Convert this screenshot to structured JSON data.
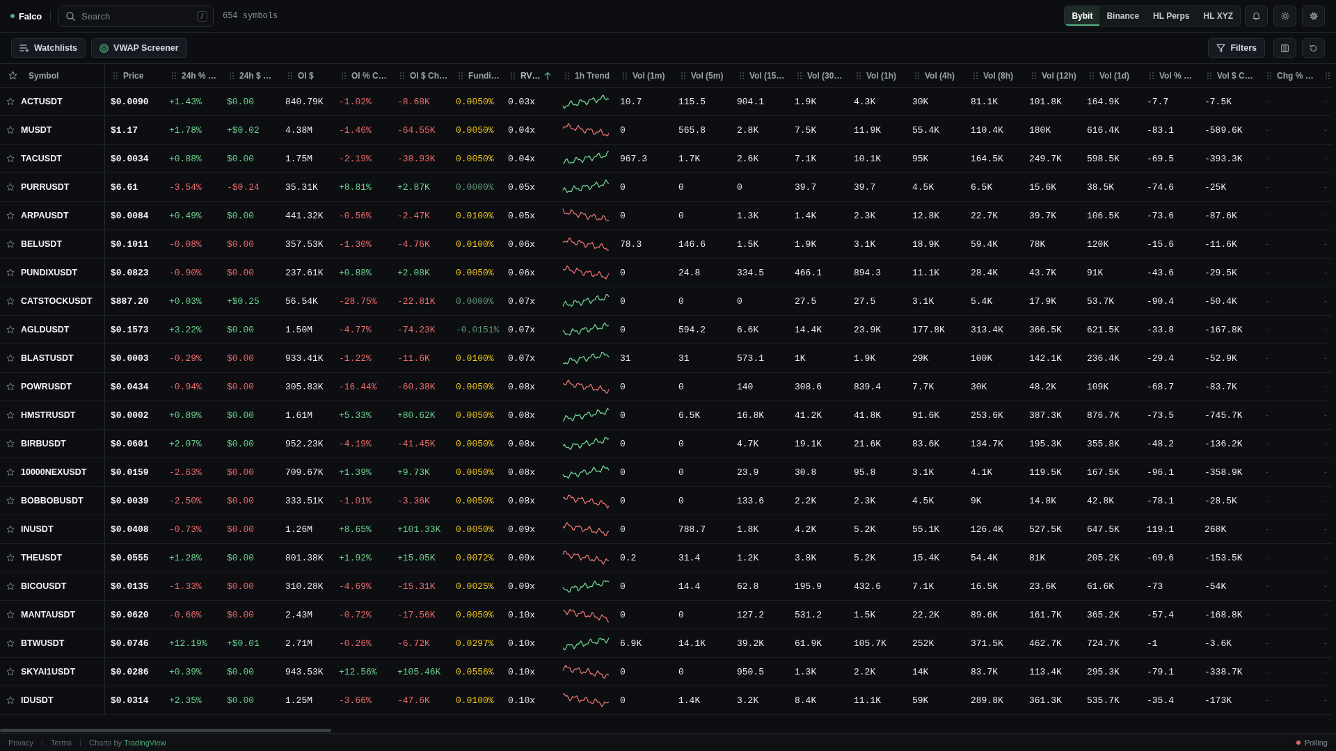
{
  "topbar": {
    "logo": "Falco",
    "search": {
      "placeholder": "Search",
      "shortcut": "/"
    },
    "symbol_count": "654 symbols",
    "exchanges": [
      {
        "label": "Bybit",
        "selected": true
      },
      {
        "label": "Binance",
        "selected": false
      },
      {
        "label": "HL Perps",
        "selected": false
      },
      {
        "label": "HL XYZ",
        "selected": false
      }
    ]
  },
  "toolbar": {
    "watchlists_button": "Watchlists",
    "vwap_button": "VWAP Screener",
    "filters_button": "Filters"
  },
  "table": {
    "symbol_header": "Symbol",
    "columns": [
      {
        "label": "Price",
        "kind": "price",
        "sorted": false
      },
      {
        "label": "24h % …",
        "kind": "day",
        "sorted": false
      },
      {
        "label": "24h $ …",
        "kind": "day",
        "sorted": false
      },
      {
        "label": "OI $",
        "kind": "plain",
        "sorted": false
      },
      {
        "label": "OI % C…",
        "kind": "oi",
        "sorted": false
      },
      {
        "label": "OI $ Ch…",
        "kind": "oi",
        "sorted": false
      },
      {
        "label": "Fundi…",
        "kind": "funding",
        "sorted": false
      },
      {
        "label": "RV…",
        "kind": "plain",
        "sorted": true
      },
      {
        "label": "1h Trend",
        "kind": "trend",
        "sorted": false
      },
      {
        "label": "Vol (1m)",
        "kind": "plain",
        "sorted": false
      },
      {
        "label": "Vol (5m)",
        "kind": "plain",
        "sorted": false
      },
      {
        "label": "Vol (15…",
        "kind": "plain",
        "sorted": false
      },
      {
        "label": "Vol (30…",
        "kind": "plain",
        "sorted": false
      },
      {
        "label": "Vol (1h)",
        "kind": "plain",
        "sorted": false
      },
      {
        "label": "Vol (4h)",
        "kind": "plain",
        "sorted": false
      },
      {
        "label": "Vol (8h)",
        "kind": "plain",
        "sorted": false
      },
      {
        "label": "Vol (12h)",
        "kind": "plain",
        "sorted": false
      },
      {
        "label": "Vol (1d)",
        "kind": "plain",
        "sorted": false
      },
      {
        "label": "Vol % …",
        "kind": "plain",
        "sorted": false
      },
      {
        "label": "Vol $ C…",
        "kind": "plain",
        "sorted": false
      },
      {
        "label": "Chg % …",
        "kind": "dash",
        "sorted": false
      },
      {
        "kind": "dash",
        "sorted": false
      }
    ],
    "rows": [
      {
        "symbol": "ACTUSDT",
        "starred": false,
        "day_up": true,
        "oi_up": false,
        "funding_positive": true,
        "trend_up": true,
        "cells": [
          "$0.0090",
          "+1.43%",
          "$0.00",
          "840.79K",
          "-1.02%",
          "-8.68K",
          "0.0050%",
          "0.03x",
          "",
          "10.7",
          "115.5",
          "904.1",
          "1.9K",
          "4.3K",
          "30K",
          "81.1K",
          "101.8K",
          "164.9K",
          "-7.7",
          "-7.5K",
          "-",
          "-"
        ]
      },
      {
        "symbol": "MUSDT",
        "starred": false,
        "day_up": true,
        "oi_up": false,
        "funding_positive": true,
        "trend_up": false,
        "cells": [
          "$1.17",
          "+1.78%",
          "+$0.02",
          "4.38M",
          "-1.46%",
          "-64.55K",
          "0.0050%",
          "0.04x",
          "",
          "0",
          "565.8",
          "2.8K",
          "7.5K",
          "11.9K",
          "55.4K",
          "110.4K",
          "180K",
          "616.4K",
          "-83.1",
          "-589.6K",
          "-",
          "-"
        ]
      },
      {
        "symbol": "TACUSDT",
        "starred": false,
        "day_up": true,
        "oi_up": false,
        "funding_positive": true,
        "trend_up": true,
        "cells": [
          "$0.0034",
          "+0.88%",
          "$0.00",
          "1.75M",
          "-2.19%",
          "-38.93K",
          "0.0050%",
          "0.04x",
          "",
          "967.3",
          "1.7K",
          "2.6K",
          "7.1K",
          "10.1K",
          "95K",
          "164.5K",
          "249.7K",
          "598.5K",
          "-69.5",
          "-393.3K",
          "-",
          "-"
        ]
      },
      {
        "symbol": "PURRUSDT",
        "starred": false,
        "day_up": false,
        "oi_up": true,
        "funding_positive": false,
        "trend_up": true,
        "cells": [
          "$6.61",
          "-3.54%",
          "-$0.24",
          "35.31K",
          "+8.81%",
          "+2.87K",
          "0.0000%",
          "0.05x",
          "",
          "0",
          "0",
          "0",
          "39.7",
          "39.7",
          "4.5K",
          "6.5K",
          "15.6K",
          "38.5K",
          "-74.6",
          "-25K",
          "-",
          "-"
        ]
      },
      {
        "symbol": "ARPAUSDT",
        "starred": false,
        "day_up": true,
        "oi_up": false,
        "funding_positive": true,
        "trend_up": false,
        "cells": [
          "$0.0084",
          "+0.49%",
          "$0.00",
          "441.32K",
          "-0.56%",
          "-2.47K",
          "0.0100%",
          "0.05x",
          "",
          "0",
          "0",
          "1.3K",
          "1.4K",
          "2.3K",
          "12.8K",
          "22.7K",
          "39.7K",
          "106.5K",
          "-73.6",
          "-87.6K",
          "-",
          "-"
        ]
      },
      {
        "symbol": "BELUSDT",
        "starred": false,
        "day_up": false,
        "oi_up": false,
        "funding_positive": true,
        "trend_up": false,
        "cells": [
          "$0.1011",
          "-0.08%",
          "$0.00",
          "357.53K",
          "-1.30%",
          "-4.76K",
          "0.0100%",
          "0.06x",
          "",
          "78.3",
          "146.6",
          "1.5K",
          "1.9K",
          "3.1K",
          "18.9K",
          "59.4K",
          "78K",
          "120K",
          "-15.6",
          "-11.6K",
          "-",
          "-"
        ]
      },
      {
        "symbol": "PUNDIXUSDT",
        "starred": false,
        "day_up": false,
        "oi_up": true,
        "funding_positive": true,
        "trend_up": false,
        "cells": [
          "$0.0823",
          "-0.90%",
          "$0.00",
          "237.61K",
          "+0.88%",
          "+2.08K",
          "0.0050%",
          "0.06x",
          "",
          "0",
          "24.8",
          "334.5",
          "466.1",
          "894.3",
          "11.1K",
          "28.4K",
          "43.7K",
          "91K",
          "-43.6",
          "-29.5K",
          "-",
          "-"
        ]
      },
      {
        "symbol": "CATSTOCKUSDT",
        "starred": false,
        "day_up": true,
        "oi_up": false,
        "funding_positive": false,
        "trend_up": true,
        "cells": [
          "$887.20",
          "+0.03%",
          "+$0.25",
          "56.54K",
          "-28.75%",
          "-22.81K",
          "0.0000%",
          "0.07x",
          "",
          "0",
          "0",
          "0",
          "27.5",
          "27.5",
          "3.1K",
          "5.4K",
          "17.9K",
          "53.7K",
          "-90.4",
          "-50.4K",
          "-",
          "-"
        ]
      },
      {
        "symbol": "AGLDUSDT",
        "starred": false,
        "day_up": true,
        "oi_up": false,
        "funding_positive": false,
        "trend_up": true,
        "cells": [
          "$0.1573",
          "+3.22%",
          "$0.00",
          "1.50M",
          "-4.77%",
          "-74.23K",
          "-0.0151%",
          "0.07x",
          "",
          "0",
          "594.2",
          "6.6K",
          "14.4K",
          "23.9K",
          "177.8K",
          "313.4K",
          "366.5K",
          "621.5K",
          "-33.8",
          "-167.8K",
          "-",
          "-"
        ]
      },
      {
        "symbol": "BLASTUSDT",
        "starred": false,
        "day_up": false,
        "oi_up": false,
        "funding_positive": true,
        "trend_up": true,
        "cells": [
          "$0.0003",
          "-0.29%",
          "$0.00",
          "933.41K",
          "-1.22%",
          "-11.6K",
          "0.0100%",
          "0.07x",
          "",
          "31",
          "31",
          "573.1",
          "1K",
          "1.9K",
          "29K",
          "100K",
          "142.1K",
          "236.4K",
          "-29.4",
          "-52.9K",
          "-",
          "-"
        ]
      },
      {
        "symbol": "POWRUSDT",
        "starred": false,
        "day_up": false,
        "oi_up": false,
        "funding_positive": true,
        "trend_up": false,
        "cells": [
          "$0.0434",
          "-0.94%",
          "$0.00",
          "305.83K",
          "-16.44%",
          "-60.38K",
          "0.0050%",
          "0.08x",
          "",
          "0",
          "0",
          "140",
          "308.6",
          "839.4",
          "7.7K",
          "30K",
          "48.2K",
          "109K",
          "-68.7",
          "-83.7K",
          "-",
          "-"
        ]
      },
      {
        "symbol": "HMSTRUSDT",
        "starred": false,
        "day_up": true,
        "oi_up": true,
        "funding_positive": true,
        "trend_up": true,
        "cells": [
          "$0.0002",
          "+0.89%",
          "$0.00",
          "1.61M",
          "+5.33%",
          "+80.62K",
          "0.0050%",
          "0.08x",
          "",
          "0",
          "6.5K",
          "16.8K",
          "41.2K",
          "41.8K",
          "91.6K",
          "253.6K",
          "387.3K",
          "876.7K",
          "-73.5",
          "-745.7K",
          "-",
          "-"
        ]
      },
      {
        "symbol": "BIRBUSDT",
        "starred": false,
        "day_up": true,
        "oi_up": false,
        "funding_positive": true,
        "trend_up": true,
        "cells": [
          "$0.0601",
          "+2.07%",
          "$0.00",
          "952.23K",
          "-4.19%",
          "-41.45K",
          "0.0050%",
          "0.08x",
          "",
          "0",
          "0",
          "4.7K",
          "19.1K",
          "21.6K",
          "83.6K",
          "134.7K",
          "195.3K",
          "355.8K",
          "-48.2",
          "-136.2K",
          "-",
          "-"
        ]
      },
      {
        "symbol": "10000NEXUSDT",
        "starred": false,
        "day_up": false,
        "oi_up": true,
        "funding_positive": true,
        "trend_up": true,
        "cells": [
          "$0.0159",
          "-2.63%",
          "$0.00",
          "709.67K",
          "+1.39%",
          "+9.73K",
          "0.0050%",
          "0.08x",
          "",
          "0",
          "0",
          "23.9",
          "30.8",
          "95.8",
          "3.1K",
          "4.1K",
          "119.5K",
          "167.5K",
          "-96.1",
          "-358.9K",
          "-",
          "-"
        ]
      },
      {
        "symbol": "BOBBOBUSDT",
        "starred": false,
        "day_up": false,
        "oi_up": false,
        "funding_positive": true,
        "trend_up": false,
        "cells": [
          "$0.0039",
          "-2.50%",
          "$0.00",
          "333.51K",
          "-1.01%",
          "-3.36K",
          "0.0050%",
          "0.08x",
          "",
          "0",
          "0",
          "133.6",
          "2.2K",
          "2.3K",
          "4.5K",
          "9K",
          "14.8K",
          "42.8K",
          "-78.1",
          "-28.5K",
          "-",
          "-"
        ]
      },
      {
        "symbol": "INUSDT",
        "starred": false,
        "day_up": false,
        "oi_up": true,
        "funding_positive": true,
        "trend_up": false,
        "cells": [
          "$0.0408",
          "-0.73%",
          "$0.00",
          "1.26M",
          "+8.65%",
          "+101.33K",
          "0.0050%",
          "0.09x",
          "",
          "0",
          "788.7",
          "1.8K",
          "4.2K",
          "5.2K",
          "55.1K",
          "126.4K",
          "527.5K",
          "647.5K",
          "119.1",
          "268K",
          "-",
          "-"
        ]
      },
      {
        "symbol": "THEUSDT",
        "starred": false,
        "day_up": true,
        "oi_up": true,
        "funding_positive": true,
        "trend_up": false,
        "cells": [
          "$0.0555",
          "+1.28%",
          "$0.00",
          "801.38K",
          "+1.92%",
          "+15.05K",
          "0.0072%",
          "0.09x",
          "",
          "0.2",
          "31.4",
          "1.2K",
          "3.8K",
          "5.2K",
          "15.4K",
          "54.4K",
          "81K",
          "205.2K",
          "-69.6",
          "-153.5K",
          "-",
          "-"
        ]
      },
      {
        "symbol": "BICOUSDT",
        "starred": false,
        "day_up": false,
        "oi_up": false,
        "funding_positive": true,
        "trend_up": true,
        "cells": [
          "$0.0135",
          "-1.33%",
          "$0.00",
          "310.28K",
          "-4.69%",
          "-15.31K",
          "0.0025%",
          "0.09x",
          "",
          "0",
          "14.4",
          "62.8",
          "195.9",
          "432.6",
          "7.1K",
          "16.5K",
          "23.6K",
          "61.6K",
          "-73",
          "-54K",
          "-",
          "-"
        ]
      },
      {
        "symbol": "MANTAUSDT",
        "starred": false,
        "day_up": false,
        "oi_up": false,
        "funding_positive": true,
        "trend_up": false,
        "cells": [
          "$0.0620",
          "-0.66%",
          "$0.00",
          "2.43M",
          "-0.72%",
          "-17.56K",
          "0.0050%",
          "0.10x",
          "",
          "0",
          "0",
          "127.2",
          "531.2",
          "1.5K",
          "22.2K",
          "89.6K",
          "161.7K",
          "365.2K",
          "-57.4",
          "-168.8K",
          "-",
          "-"
        ]
      },
      {
        "symbol": "BTWUSDT",
        "starred": false,
        "day_up": true,
        "oi_up": false,
        "funding_positive": true,
        "trend_up": true,
        "cells": [
          "$0.0746",
          "+12.19%",
          "+$0.01",
          "2.71M",
          "-0.26%",
          "-6.72K",
          "0.0297%",
          "0.10x",
          "",
          "6.9K",
          "14.1K",
          "39.2K",
          "61.9K",
          "105.7K",
          "252K",
          "371.5K",
          "462.7K",
          "724.7K",
          "-1",
          "-3.6K",
          "-",
          "-"
        ]
      },
      {
        "symbol": "SKYAI1USDT",
        "starred": false,
        "day_up": true,
        "oi_up": true,
        "funding_positive": true,
        "trend_up": false,
        "cells": [
          "$0.0286",
          "+0.39%",
          "$0.00",
          "943.53K",
          "+12.56%",
          "+105.46K",
          "0.0556%",
          "0.10x",
          "",
          "0",
          "0",
          "950.5",
          "1.3K",
          "2.2K",
          "14K",
          "83.7K",
          "113.4K",
          "295.3K",
          "-79.1",
          "-338.7K",
          "-",
          "-"
        ]
      },
      {
        "symbol": "IDUSDT",
        "starred": false,
        "day_up": true,
        "oi_up": false,
        "funding_positive": true,
        "trend_up": false,
        "cells": [
          "$0.0314",
          "+2.35%",
          "$0.00",
          "1.25M",
          "-3.66%",
          "-47.6K",
          "0.0100%",
          "0.10x",
          "",
          "0",
          "1.4K",
          "3.2K",
          "8.4K",
          "11.1K",
          "59K",
          "289.8K",
          "361.3K",
          "535.7K",
          "-35.4",
          "-173K",
          "-",
          "-"
        ]
      }
    ]
  },
  "footer": {
    "links": [
      "Privacy",
      "Terms"
    ],
    "credit": "Charts by",
    "credit_link": "TradingView",
    "status": "Polling"
  }
}
